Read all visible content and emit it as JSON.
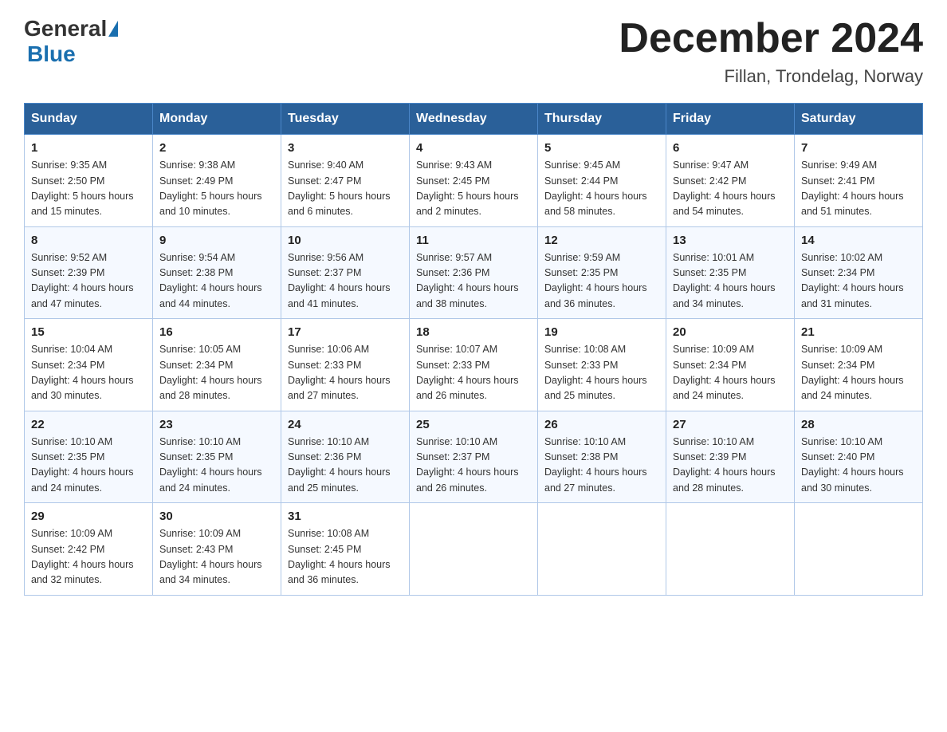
{
  "logo": {
    "general": "General",
    "blue": "Blue"
  },
  "header": {
    "month_title": "December 2024",
    "location": "Fillan, Trondelag, Norway"
  },
  "weekdays": [
    "Sunday",
    "Monday",
    "Tuesday",
    "Wednesday",
    "Thursday",
    "Friday",
    "Saturday"
  ],
  "weeks": [
    [
      {
        "day": "1",
        "sunrise": "9:35 AM",
        "sunset": "2:50 PM",
        "daylight": "5 hours and 15 minutes."
      },
      {
        "day": "2",
        "sunrise": "9:38 AM",
        "sunset": "2:49 PM",
        "daylight": "5 hours and 10 minutes."
      },
      {
        "day": "3",
        "sunrise": "9:40 AM",
        "sunset": "2:47 PM",
        "daylight": "5 hours and 6 minutes."
      },
      {
        "day": "4",
        "sunrise": "9:43 AM",
        "sunset": "2:45 PM",
        "daylight": "5 hours and 2 minutes."
      },
      {
        "day": "5",
        "sunrise": "9:45 AM",
        "sunset": "2:44 PM",
        "daylight": "4 hours and 58 minutes."
      },
      {
        "day": "6",
        "sunrise": "9:47 AM",
        "sunset": "2:42 PM",
        "daylight": "4 hours and 54 minutes."
      },
      {
        "day": "7",
        "sunrise": "9:49 AM",
        "sunset": "2:41 PM",
        "daylight": "4 hours and 51 minutes."
      }
    ],
    [
      {
        "day": "8",
        "sunrise": "9:52 AM",
        "sunset": "2:39 PM",
        "daylight": "4 hours and 47 minutes."
      },
      {
        "day": "9",
        "sunrise": "9:54 AM",
        "sunset": "2:38 PM",
        "daylight": "4 hours and 44 minutes."
      },
      {
        "day": "10",
        "sunrise": "9:56 AM",
        "sunset": "2:37 PM",
        "daylight": "4 hours and 41 minutes."
      },
      {
        "day": "11",
        "sunrise": "9:57 AM",
        "sunset": "2:36 PM",
        "daylight": "4 hours and 38 minutes."
      },
      {
        "day": "12",
        "sunrise": "9:59 AM",
        "sunset": "2:35 PM",
        "daylight": "4 hours and 36 minutes."
      },
      {
        "day": "13",
        "sunrise": "10:01 AM",
        "sunset": "2:35 PM",
        "daylight": "4 hours and 34 minutes."
      },
      {
        "day": "14",
        "sunrise": "10:02 AM",
        "sunset": "2:34 PM",
        "daylight": "4 hours and 31 minutes."
      }
    ],
    [
      {
        "day": "15",
        "sunrise": "10:04 AM",
        "sunset": "2:34 PM",
        "daylight": "4 hours and 30 minutes."
      },
      {
        "day": "16",
        "sunrise": "10:05 AM",
        "sunset": "2:34 PM",
        "daylight": "4 hours and 28 minutes."
      },
      {
        "day": "17",
        "sunrise": "10:06 AM",
        "sunset": "2:33 PM",
        "daylight": "4 hours and 27 minutes."
      },
      {
        "day": "18",
        "sunrise": "10:07 AM",
        "sunset": "2:33 PM",
        "daylight": "4 hours and 26 minutes."
      },
      {
        "day": "19",
        "sunrise": "10:08 AM",
        "sunset": "2:33 PM",
        "daylight": "4 hours and 25 minutes."
      },
      {
        "day": "20",
        "sunrise": "10:09 AM",
        "sunset": "2:34 PM",
        "daylight": "4 hours and 24 minutes."
      },
      {
        "day": "21",
        "sunrise": "10:09 AM",
        "sunset": "2:34 PM",
        "daylight": "4 hours and 24 minutes."
      }
    ],
    [
      {
        "day": "22",
        "sunrise": "10:10 AM",
        "sunset": "2:35 PM",
        "daylight": "4 hours and 24 minutes."
      },
      {
        "day": "23",
        "sunrise": "10:10 AM",
        "sunset": "2:35 PM",
        "daylight": "4 hours and 24 minutes."
      },
      {
        "day": "24",
        "sunrise": "10:10 AM",
        "sunset": "2:36 PM",
        "daylight": "4 hours and 25 minutes."
      },
      {
        "day": "25",
        "sunrise": "10:10 AM",
        "sunset": "2:37 PM",
        "daylight": "4 hours and 26 minutes."
      },
      {
        "day": "26",
        "sunrise": "10:10 AM",
        "sunset": "2:38 PM",
        "daylight": "4 hours and 27 minutes."
      },
      {
        "day": "27",
        "sunrise": "10:10 AM",
        "sunset": "2:39 PM",
        "daylight": "4 hours and 28 minutes."
      },
      {
        "day": "28",
        "sunrise": "10:10 AM",
        "sunset": "2:40 PM",
        "daylight": "4 hours and 30 minutes."
      }
    ],
    [
      {
        "day": "29",
        "sunrise": "10:09 AM",
        "sunset": "2:42 PM",
        "daylight": "4 hours and 32 minutes."
      },
      {
        "day": "30",
        "sunrise": "10:09 AM",
        "sunset": "2:43 PM",
        "daylight": "4 hours and 34 minutes."
      },
      {
        "day": "31",
        "sunrise": "10:08 AM",
        "sunset": "2:45 PM",
        "daylight": "4 hours and 36 minutes."
      },
      null,
      null,
      null,
      null
    ]
  ],
  "labels": {
    "sunrise": "Sunrise:",
    "sunset": "Sunset:",
    "daylight": "Daylight:"
  }
}
